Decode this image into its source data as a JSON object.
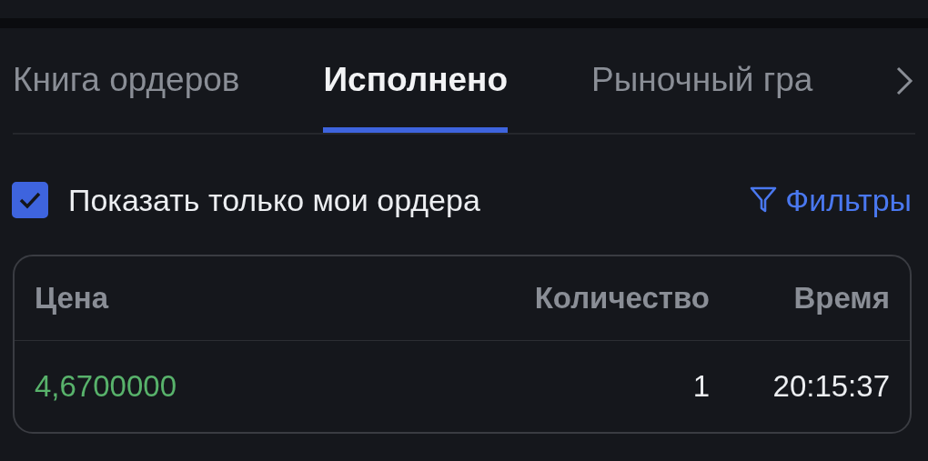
{
  "tabs": [
    {
      "label": "Книга ордеров",
      "selected": false
    },
    {
      "label": "Исполнено",
      "selected": true
    },
    {
      "label": "Рыночный гра",
      "selected": false
    }
  ],
  "filter_bar": {
    "show_mine": {
      "label": "Показать только мои ордера",
      "checked": true
    },
    "filters_link": "Фильтры"
  },
  "table": {
    "columns": [
      "Цена",
      "Количество",
      "Время"
    ],
    "rows": [
      {
        "kind": "buy",
        "cells": [
          "4,6700000",
          "1",
          "20:15:37"
        ]
      }
    ]
  }
}
